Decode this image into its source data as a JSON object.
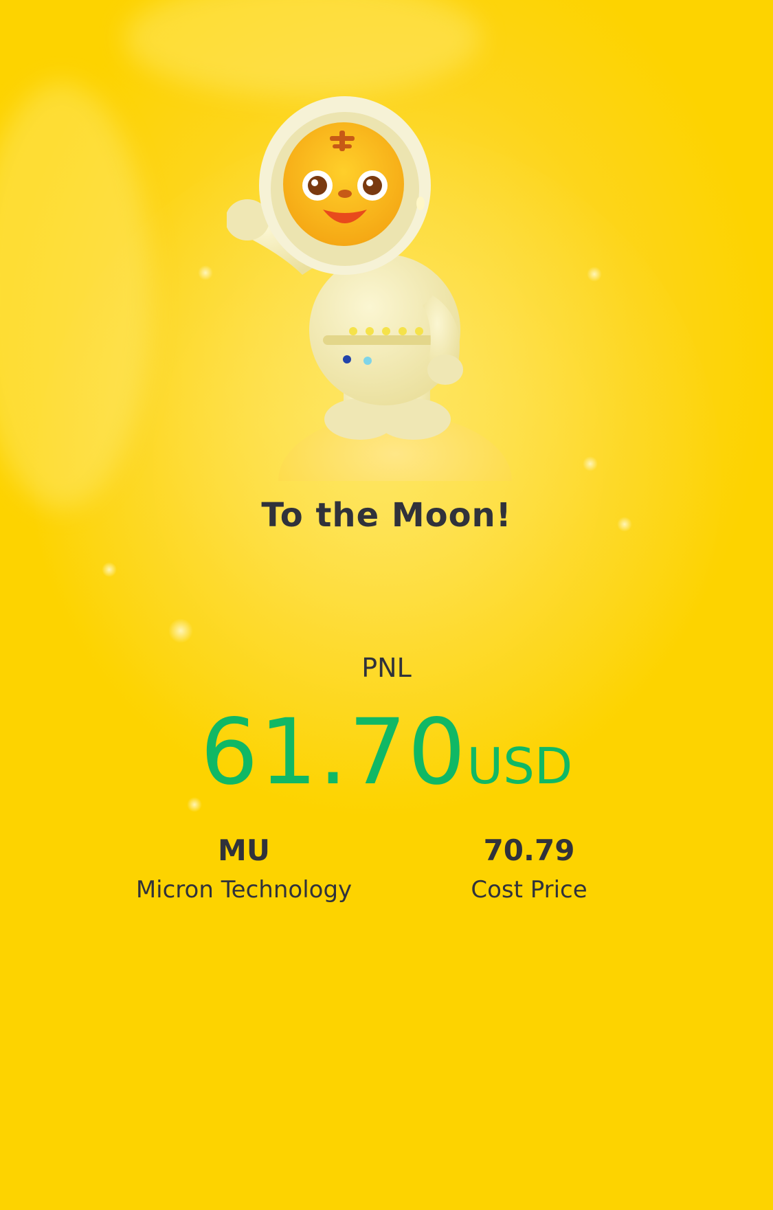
{
  "card": {
    "title": "To the Moon!",
    "mascot": "tiger-astronaut-mascot-illustration"
  },
  "pnl": {
    "label": "PNL",
    "amount": "61.70",
    "currency": "USD",
    "color": "#10b865"
  },
  "stock": {
    "symbol": "MU",
    "name": "Micron Technology"
  },
  "cost": {
    "value": "70.79",
    "label": "Cost Price"
  },
  "colors": {
    "background": "#fdd300",
    "text": "#30323b",
    "positive": "#10b865"
  }
}
